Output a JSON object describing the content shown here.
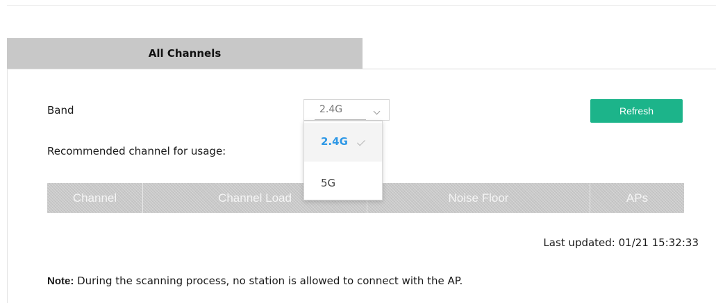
{
  "tabs": [
    {
      "label": "All Channels",
      "active": true
    }
  ],
  "band": {
    "label": "Band",
    "selected": "2.4G",
    "options": [
      "2.4G",
      "5G"
    ]
  },
  "refresh_label": "Refresh",
  "recommended_label": "Recommended channel for usage:",
  "table": {
    "columns": [
      "Channel",
      "Channel Load",
      "Noise Floor",
      "APs"
    ]
  },
  "last_updated": "Last updated: 01/21 15:32:33",
  "note": {
    "prefix": "Note:",
    "text": " During the scanning process, no station is allowed to connect with the AP."
  },
  "colors": {
    "accent": "#1cb48a",
    "selected_option": "#2e98e6",
    "tab_bg": "#c8c8c8"
  },
  "icons": {
    "select": "chevron-down-icon",
    "selected_option": "check-icon"
  }
}
